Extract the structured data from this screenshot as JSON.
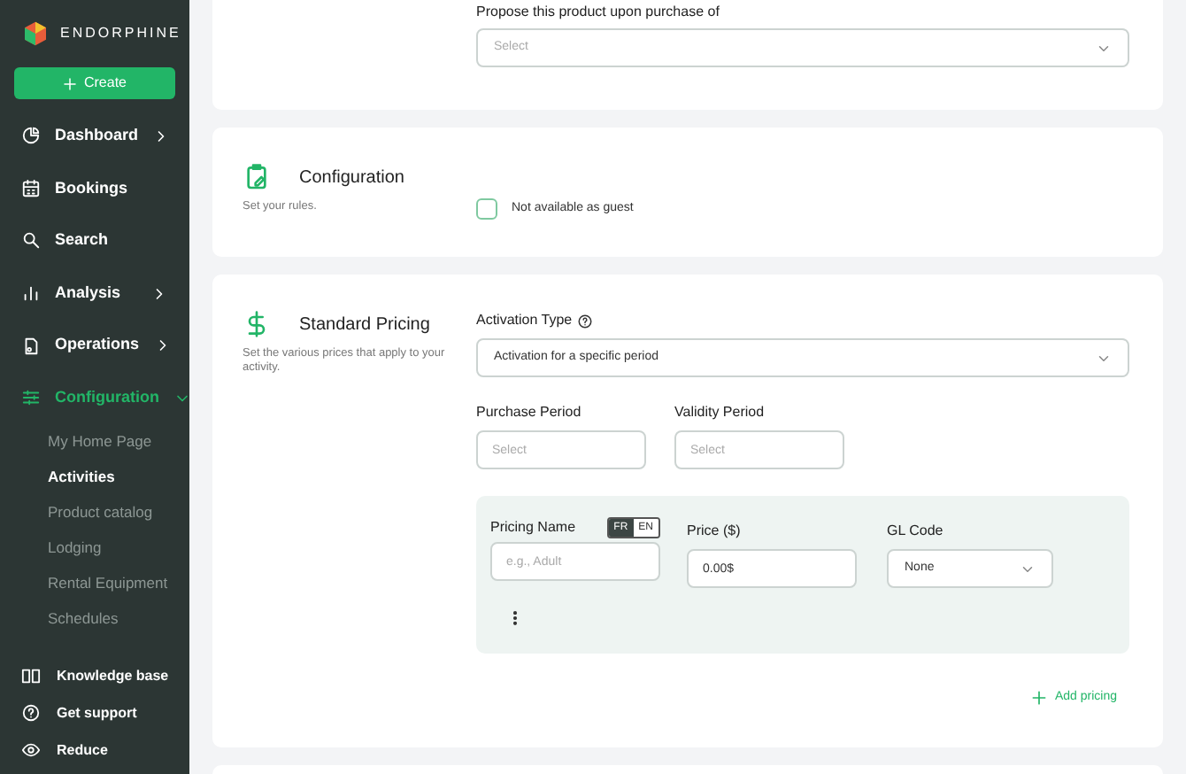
{
  "sidebar": {
    "brand": "ENDORPHINE",
    "create_button": "Create",
    "items": [
      {
        "label": "Dashboard",
        "has_arrow": true,
        "expanded": false,
        "selected": false
      },
      {
        "label": "Bookings",
        "selected": false
      },
      {
        "label": "Search",
        "selected": false
      },
      {
        "label": "Analysis",
        "has_arrow": true,
        "expanded": false,
        "selected": false
      },
      {
        "label": "Operations",
        "has_arrow": true,
        "expanded": false,
        "selected": false
      },
      {
        "label": "Configuration",
        "has_arrow": true,
        "expanded": true,
        "selected": true,
        "children": [
          {
            "label": "My Home Page",
            "selected": false
          },
          {
            "label": "Activities",
            "selected": true
          },
          {
            "label": "Product catalog",
            "selected": false
          },
          {
            "label": "Lodging",
            "selected": false
          },
          {
            "label": "Rental Equipment",
            "selected": false
          },
          {
            "label": "Schedules",
            "selected": false
          }
        ]
      }
    ],
    "footer": [
      {
        "label": "Knowledge base"
      },
      {
        "label": "Get support"
      },
      {
        "label": "Reduce"
      }
    ]
  },
  "upsell": {
    "label": "Propose this product upon purchase of",
    "placeholder": "Select"
  },
  "configuration": {
    "title": "Configuration",
    "subtitle": "Set your rules.",
    "checkbox": {
      "label": "Not available as guest",
      "checked": false
    }
  },
  "pricing": {
    "title": "Standard Pricing",
    "subtitle": "Set the various prices that apply to your activity.",
    "activation_label": "Activation Type",
    "activation_value": "Activation for a specific period",
    "purchase_label": "Purchase Period",
    "purchase_placeholder": "Select",
    "validity_label": "Validity Period",
    "validity_placeholder": "Select",
    "row": {
      "name_label": "Pricing Name",
      "languages": [
        {
          "label": "FR",
          "selected": true
        },
        {
          "label": "EN",
          "selected": false
        }
      ],
      "name_placeholder": "e.g., Adult",
      "price_label": "Price ($)",
      "price_value": "0.00$",
      "gl_label": "GL Code",
      "gl_value": "None"
    },
    "add_button": "Add pricing"
  }
}
